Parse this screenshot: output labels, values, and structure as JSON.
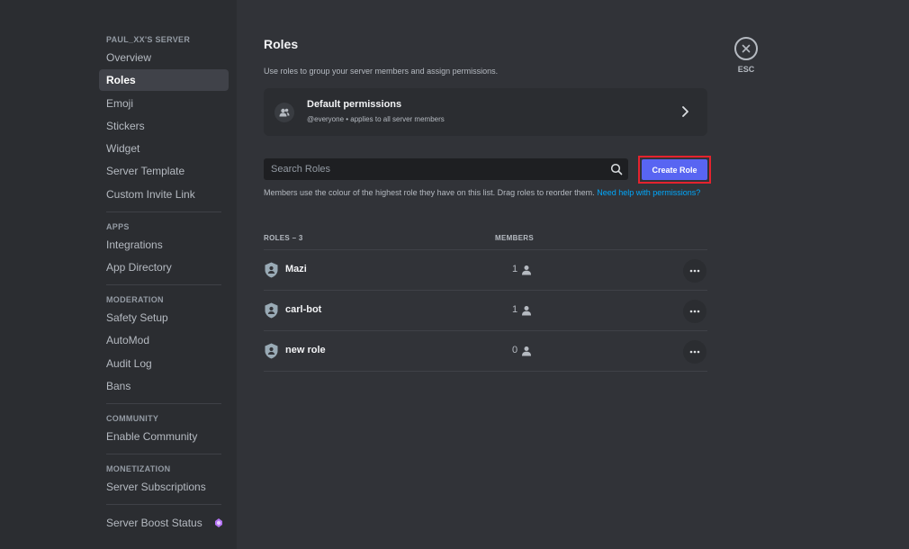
{
  "sidebar": {
    "server_header": "PAUL_XX'S SERVER",
    "server_items": [
      {
        "label": "Overview"
      },
      {
        "label": "Roles"
      },
      {
        "label": "Emoji"
      },
      {
        "label": "Stickers"
      },
      {
        "label": "Widget"
      },
      {
        "label": "Server Template"
      },
      {
        "label": "Custom Invite Link"
      }
    ],
    "apps_header": "APPS",
    "apps_items": [
      {
        "label": "Integrations"
      },
      {
        "label": "App Directory"
      }
    ],
    "moderation_header": "MODERATION",
    "moderation_items": [
      {
        "label": "Safety Setup"
      },
      {
        "label": "AutoMod"
      },
      {
        "label": "Audit Log"
      },
      {
        "label": "Bans"
      }
    ],
    "community_header": "COMMUNITY",
    "community_items": [
      {
        "label": "Enable Community"
      }
    ],
    "monetization_header": "MONETIZATION",
    "monetization_items": [
      {
        "label": "Server Subscriptions"
      }
    ],
    "boost_item": {
      "label": "Server Boost Status",
      "icon": "boost-gem-icon"
    },
    "active_item": "Roles"
  },
  "main": {
    "title": "Roles",
    "description": "Use roles to group your server members and assign permissions.",
    "default_permissions": {
      "title": "Default permissions",
      "subtitle": "@everyone • applies to all server members"
    },
    "search": {
      "placeholder": "Search Roles",
      "value": ""
    },
    "create_role_label": "Create Role",
    "help_text": "Members use the colour of the highest role they have on this list. Drag roles to reorder them.",
    "help_link": "Need help with permissions?",
    "table": {
      "roles_header": "ROLES – 3",
      "members_header": "MEMBERS",
      "rows": [
        {
          "name": "Mazi",
          "members": "1"
        },
        {
          "name": "carl-bot",
          "members": "1"
        },
        {
          "name": "new role",
          "members": "0"
        }
      ]
    },
    "close_label": "ESC"
  },
  "colors": {
    "accent": "#5865f2",
    "highlight_border": "#e4232e",
    "link": "#00a8fc",
    "boost": "#b473f5"
  }
}
